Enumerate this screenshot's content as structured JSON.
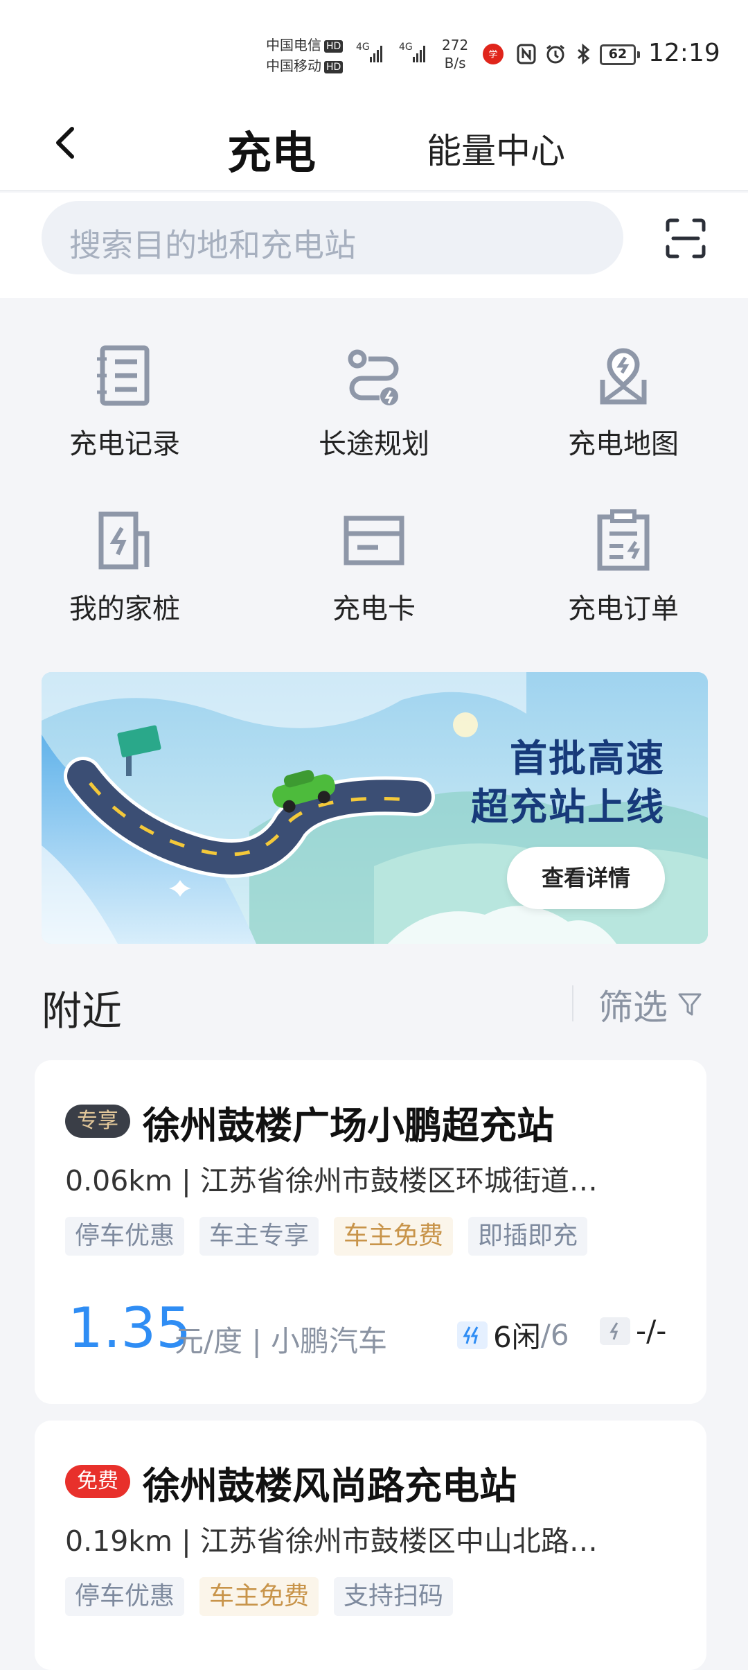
{
  "status_bar": {
    "carrier1": "中国电信",
    "carrier2": "中国移动",
    "hd": "HD",
    "net1": "4G",
    "net2": "4G",
    "net_speed_value": "272",
    "net_speed_unit": "B/s",
    "battery": "62",
    "time": "12:19"
  },
  "header": {
    "title": "充电",
    "second_tab": "能量中心"
  },
  "search": {
    "placeholder": "搜索目的地和充电站"
  },
  "quick_menu": [
    {
      "label": "充电记录",
      "icon": "record-icon"
    },
    {
      "label": "长途规划",
      "icon": "route-icon"
    },
    {
      "label": "充电地图",
      "icon": "map-pin-icon"
    },
    {
      "label": "我的家桩",
      "icon": "home-charger-icon"
    },
    {
      "label": "充电卡",
      "icon": "card-icon"
    },
    {
      "label": "充电订单",
      "icon": "order-icon"
    }
  ],
  "banner": {
    "line1": "首批高速",
    "line2": "超充站上线",
    "cta": "查看详情"
  },
  "nearby": {
    "title": "附近",
    "filter": "筛选"
  },
  "stations": [
    {
      "badge": "专享",
      "name": "徐州鼓楼广场小鹏超充站",
      "address": "0.06km | 江苏省徐州市鼓楼区环城街道…",
      "tags": [
        "停车优惠",
        "车主专享",
        "车主免费",
        "即插即充"
      ],
      "price": "1.35",
      "price_unit": "元/度 | 小鹏汽车",
      "fast_free": "6闲",
      "fast_total": "/6",
      "slow": "-/-"
    },
    {
      "badge": "免费",
      "name": "徐州鼓楼风尚路充电站",
      "address": "0.19km | 江苏省徐州市鼓楼区中山北路…",
      "tags": [
        "停车优惠",
        "车主免费",
        "支持扫码"
      ]
    }
  ],
  "colors": {
    "accent": "#2f8df4",
    "gold": "#c8944a",
    "red_badge": "#e8302b"
  }
}
